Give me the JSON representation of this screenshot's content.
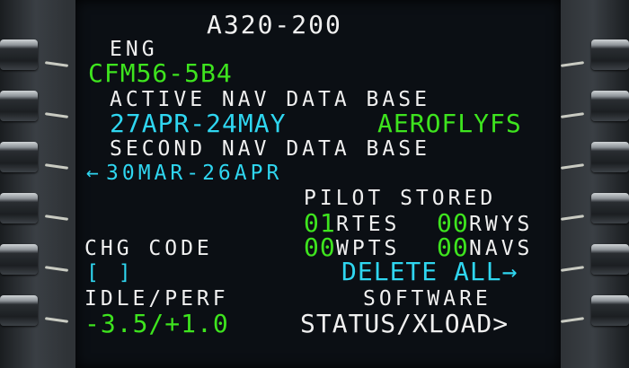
{
  "page_title": "A320-200",
  "engine": {
    "label": "ENG",
    "value": "CFM56-5B4"
  },
  "active_nav_db": {
    "label": "ACTIVE NAV DATA BASE",
    "dates": "27APR-24MAY",
    "provider": "AEROFLYFS"
  },
  "second_nav_db": {
    "label": "SECOND NAV DATA BASE",
    "arrow": "←",
    "dates": "30MAR-26APR"
  },
  "pilot_stored": {
    "label": "PILOT STORED",
    "rtes_count": "01",
    "rtes_label": "RTES",
    "rwys_count": "00",
    "rwys_label": "RWYS",
    "wpts_count": "00",
    "wpts_label": "WPTS",
    "navs_count": "00",
    "navs_label": "NAVS",
    "delete_all": "DELETE ALL→"
  },
  "chg_code": {
    "label": "CHG CODE",
    "value": "[ ]"
  },
  "idle_perf": {
    "label": "IDLE/PERF",
    "value": "-3.5/+1.0"
  },
  "software": {
    "label": "SOFTWARE",
    "action": "STATUS/XLOAD>"
  },
  "colors": {
    "white": "#f0f0f0",
    "green": "#3ee41e",
    "cyan": "#2fd6f0",
    "screen_bg": "#0b0f14"
  }
}
